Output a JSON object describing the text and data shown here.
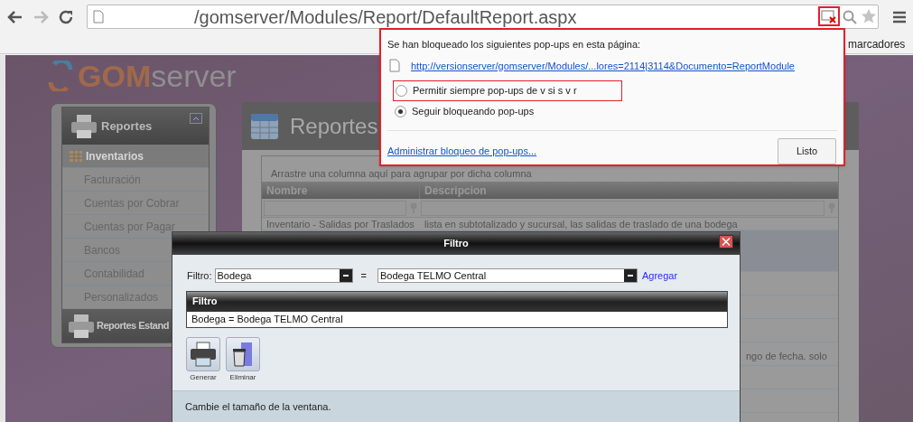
{
  "browser": {
    "url": "/gomserver/Modules/Report/DefaultReport.aspx",
    "bookmarks_text": "marcadores"
  },
  "popup_blocker": {
    "heading": "Se han bloqueado los siguientes pop-ups en esta página:",
    "link": "http://versionserver/gomserver/Modules/...lores=2114|3114&Documento=ReportModule",
    "options": [
      {
        "label": "Permitir siempre pop-ups de v si s v r",
        "selected": false
      },
      {
        "label": "Seguir bloqueando pop-ups",
        "selected": true
      }
    ],
    "manage_link": "Administrar bloqueo de pop-ups...",
    "done_button": "Listo"
  },
  "app": {
    "logo": {
      "part_1": "GOM",
      "part_2": "server"
    },
    "sidebar": {
      "header": "Reportes",
      "items": [
        {
          "label": "Inventarios",
          "selected": true
        },
        {
          "label": "Facturación",
          "selected": false
        },
        {
          "label": "Cuentas por Cobrar",
          "selected": false
        },
        {
          "label": "Cuentas por Pagar",
          "selected": false
        },
        {
          "label": "Bancos",
          "selected": false
        },
        {
          "label": "Contabilidad",
          "selected": false
        },
        {
          "label": "Personalizados",
          "selected": false
        }
      ],
      "footer_header": "Reportes Estand"
    },
    "main": {
      "title": "Reportes",
      "group_hint": "Arrastre una columna aquí para agrupar por dicha columna",
      "columns": [
        "Nombre",
        "Descripcion"
      ],
      "rows": [
        {
          "nombre": "Inventario - Salidas por Traslados",
          "descripcion": "lista en subtotalizado y sucursal, las salidas de traslado de una bodega"
        }
      ],
      "partial_text": "ngo de fecha. solo"
    }
  },
  "dialog": {
    "title": "Filtro",
    "filter_label": "Filtro:",
    "field": "Bodega",
    "operator": "=",
    "value": "Bodega TELMO Central",
    "add_link": "Agregar",
    "table": {
      "column": "Filtro",
      "rows": [
        "Bodega = Bodega TELMO Central"
      ]
    },
    "buttons": [
      {
        "kind": "print",
        "label": "Generar"
      },
      {
        "kind": "delete",
        "label": "Eliminar"
      }
    ],
    "status": "Cambie el tamaño de la ventana."
  }
}
